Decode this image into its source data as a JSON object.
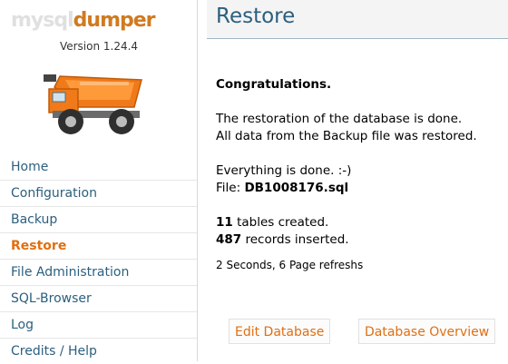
{
  "app": {
    "version": "Version 1.24.4",
    "logo_text_1": "mysql",
    "logo_text_2": "dumper"
  },
  "sidebar": {
    "items": [
      {
        "label": "Home"
      },
      {
        "label": "Configuration"
      },
      {
        "label": "Backup"
      },
      {
        "label": "Restore"
      },
      {
        "label": "File Administration"
      },
      {
        "label": "SQL-Browser"
      },
      {
        "label": "Log"
      },
      {
        "label": "Credits / Help"
      }
    ],
    "active_index": 3
  },
  "header": {
    "title": "Restore"
  },
  "main": {
    "heading": "Congratulations.",
    "line1": "The restoration of the database is done.",
    "line2": "All data from the Backup file was restored.",
    "done_text": "Everything is done. :-)",
    "file_label": "File: ",
    "file_name": "DB1008176.sql",
    "tables_count": "11",
    "tables_text": " tables created.",
    "records_count": "487",
    "records_text": " records inserted.",
    "timing": "2 Seconds, 6 Page refreshs"
  },
  "buttons": {
    "edit_db": "Edit Database",
    "db_overview": "Database Overview"
  },
  "colors": {
    "accent": "#e06f12",
    "link": "#2b5f7f",
    "header_bg": "#f4f4f4"
  },
  "icons": {
    "logo": "mysqldumper-logo",
    "mascot": "dump-truck-icon"
  }
}
